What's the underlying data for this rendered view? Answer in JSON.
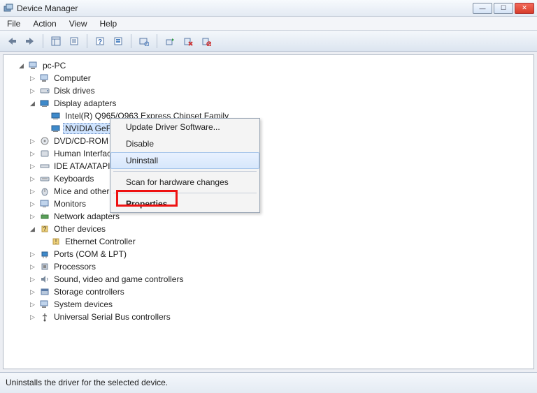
{
  "window": {
    "title": "Device Manager"
  },
  "menubar": {
    "file": "File",
    "action": "Action",
    "view": "View",
    "help": "Help"
  },
  "tree": {
    "root": "pc-PC",
    "nodes": {
      "computer": "Computer",
      "disk_drives": "Disk drives",
      "display_adapters": "Display adapters",
      "intel_gpu": "Intel(R)  Q965/Q963 Express Chipset Family",
      "nvidia_gpu": "NVIDIA GeFo",
      "dvd": "DVD/CD-ROM d",
      "hid": "Human Interface",
      "ide": "IDE ATA/ATAPI",
      "keyboards": "Keyboards",
      "mice": "Mice and other p",
      "monitors": "Monitors",
      "network": "Network adapters",
      "other": "Other devices",
      "ethernet": "Ethernet Controller",
      "ports": "Ports (COM & LPT)",
      "processors": "Processors",
      "sound": "Sound, video and game controllers",
      "storage": "Storage controllers",
      "system": "System devices",
      "usb": "Universal Serial Bus controllers"
    }
  },
  "context_menu": {
    "update": "Update Driver Software...",
    "disable": "Disable",
    "uninstall": "Uninstall",
    "scan": "Scan for hardware changes",
    "properties": "Properties"
  },
  "statusbar": {
    "text": "Uninstalls the driver for the selected device."
  }
}
